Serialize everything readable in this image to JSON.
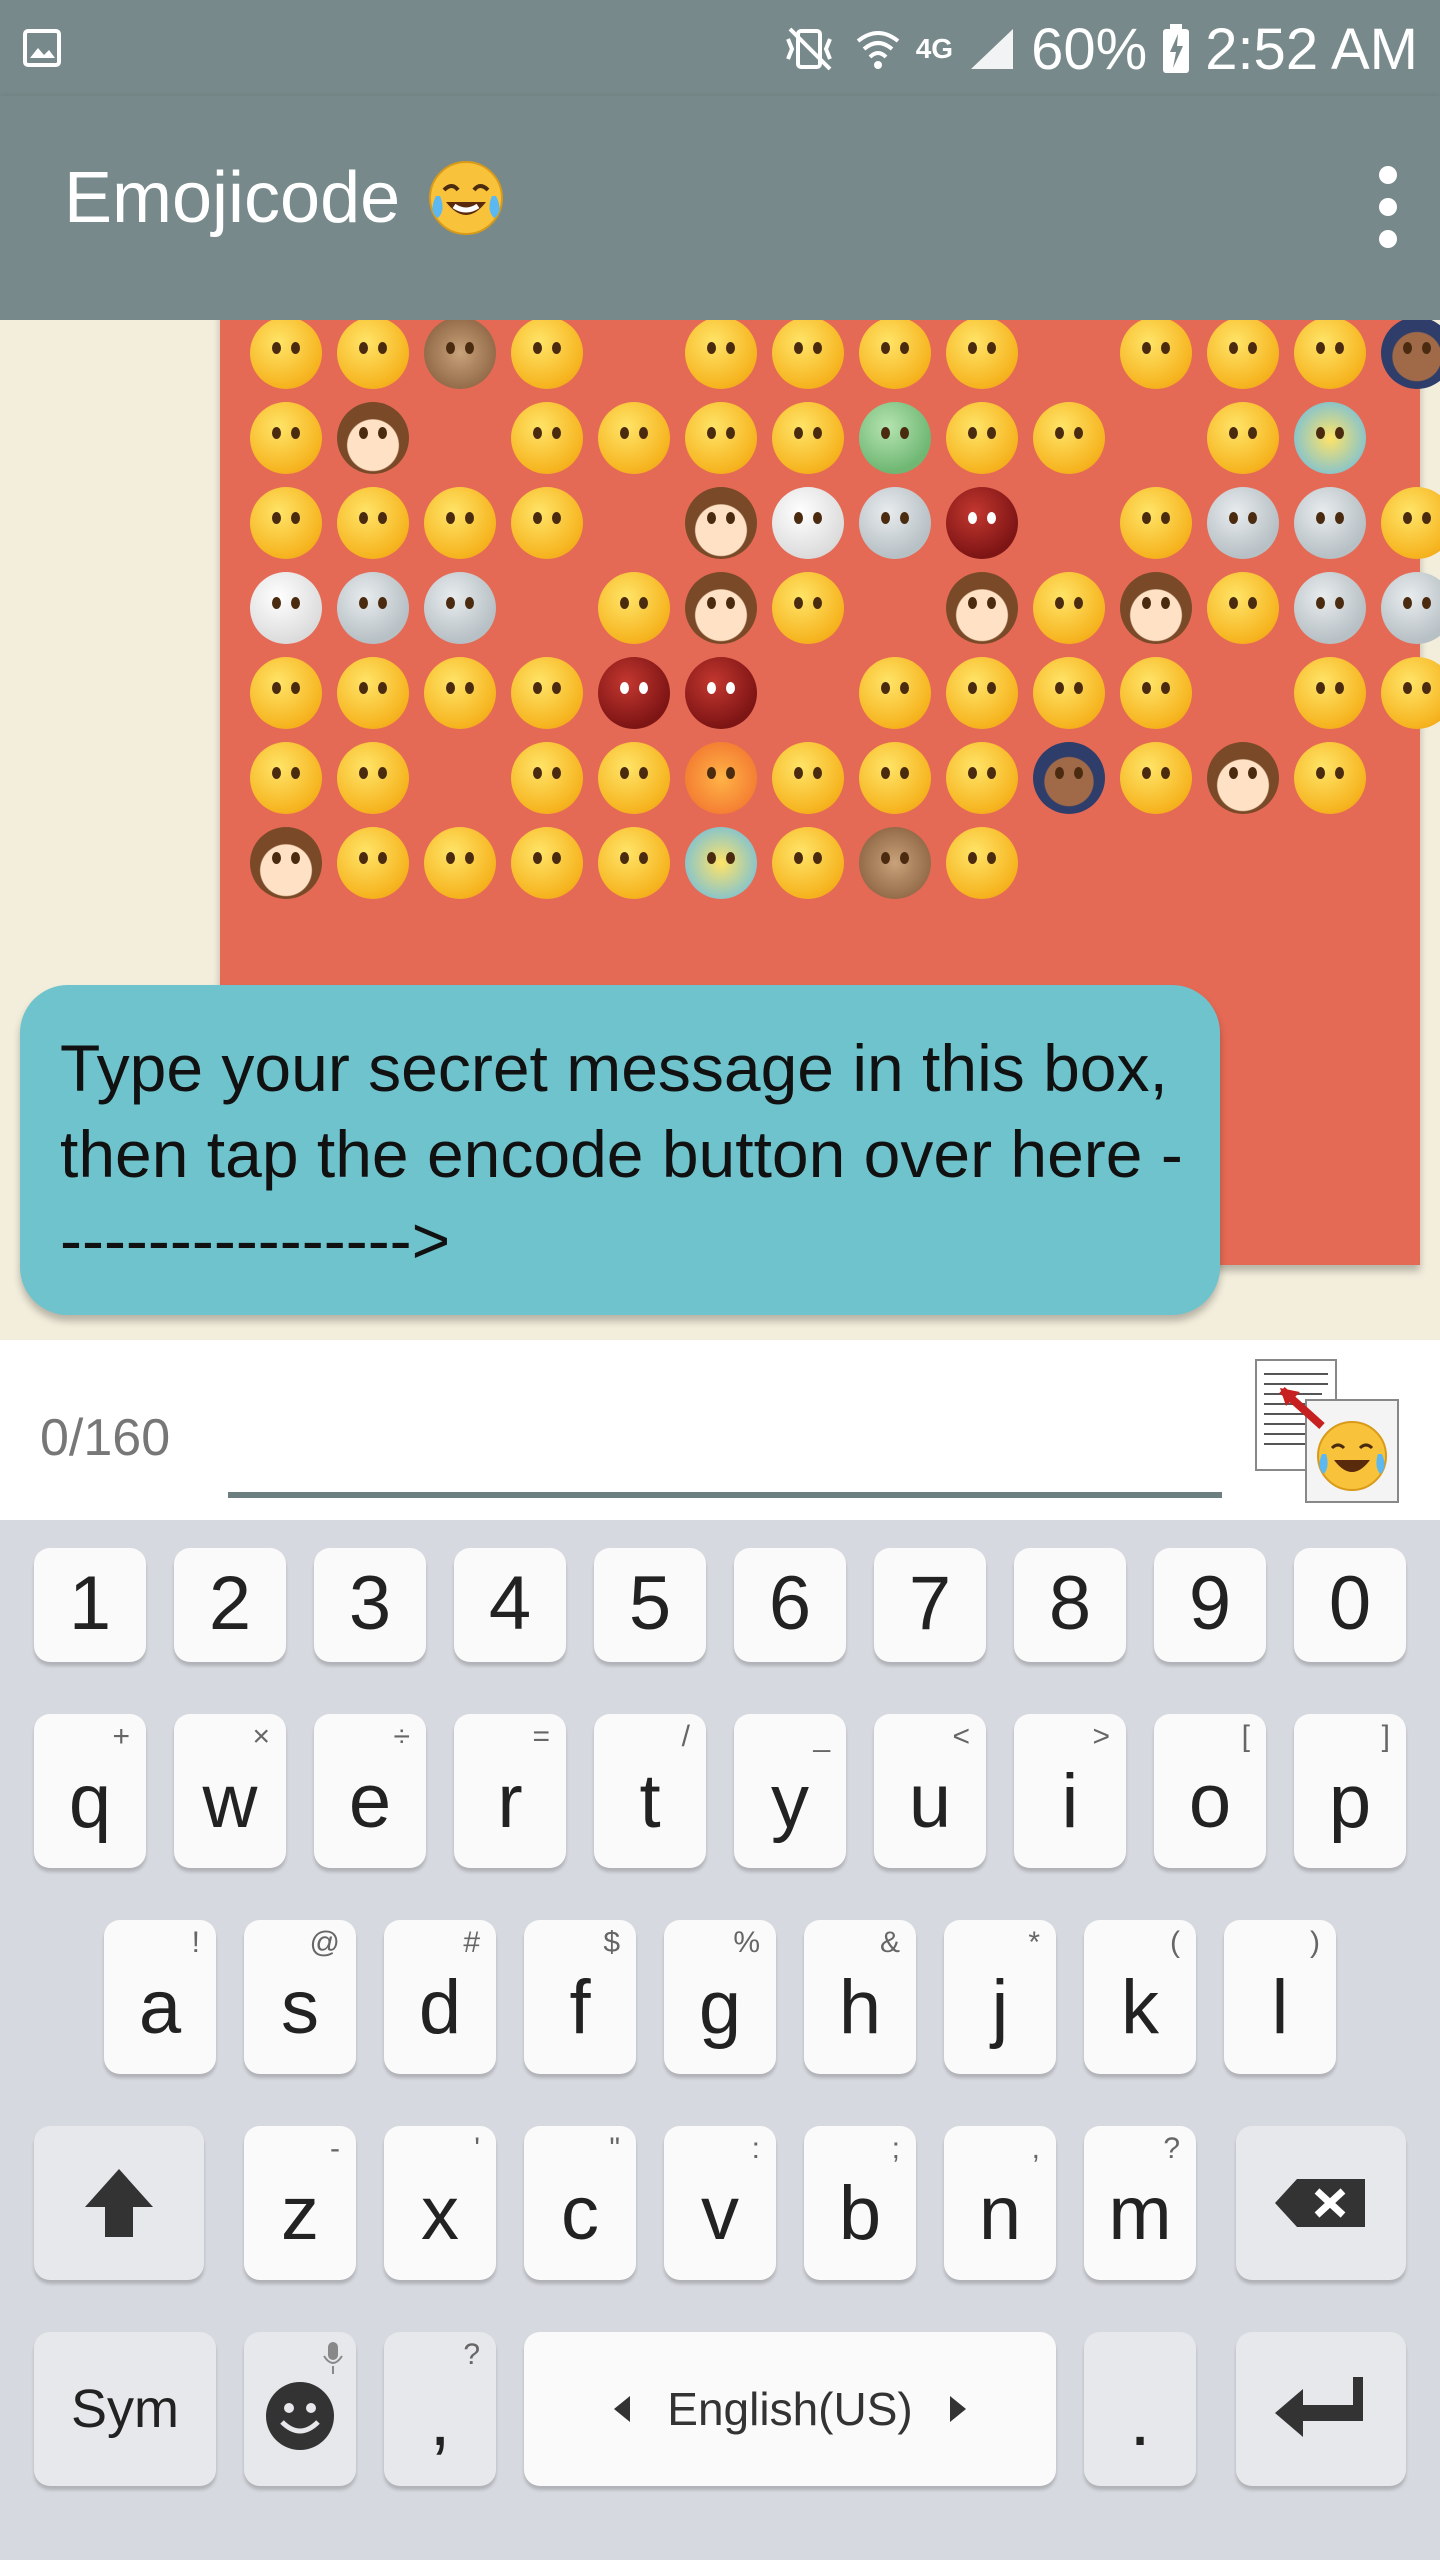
{
  "status_bar": {
    "battery": "60%",
    "time": "2:52 AM",
    "network": "4G"
  },
  "app_bar": {
    "title": "Emojicode"
  },
  "chat": {
    "hint_message": "Type your secret message in this box, then tap the encode button over here  ----------------->"
  },
  "input": {
    "counter": "0/160",
    "value": "",
    "placeholder": ""
  },
  "keyboard": {
    "number_row": [
      "1",
      "2",
      "3",
      "4",
      "5",
      "6",
      "7",
      "8",
      "9",
      "0"
    ],
    "row1": [
      {
        "key": "q",
        "sub": "+"
      },
      {
        "key": "w",
        "sub": "×"
      },
      {
        "key": "e",
        "sub": "÷"
      },
      {
        "key": "r",
        "sub": "="
      },
      {
        "key": "t",
        "sub": "/"
      },
      {
        "key": "y",
        "sub": "_"
      },
      {
        "key": "u",
        "sub": "<"
      },
      {
        "key": "i",
        "sub": ">"
      },
      {
        "key": "o",
        "sub": "["
      },
      {
        "key": "p",
        "sub": "]"
      }
    ],
    "row2": [
      {
        "key": "a",
        "sub": "!"
      },
      {
        "key": "s",
        "sub": "@"
      },
      {
        "key": "d",
        "sub": "#"
      },
      {
        "key": "f",
        "sub": "$"
      },
      {
        "key": "g",
        "sub": "%"
      },
      {
        "key": "h",
        "sub": "&"
      },
      {
        "key": "j",
        "sub": "*"
      },
      {
        "key": "k",
        "sub": "("
      },
      {
        "key": "l",
        "sub": ")"
      }
    ],
    "row3": [
      {
        "key": "z",
        "sub": "-"
      },
      {
        "key": "x",
        "sub": "'"
      },
      {
        "key": "c",
        "sub": "\""
      },
      {
        "key": "v",
        "sub": ":"
      },
      {
        "key": "b",
        "sub": ";"
      },
      {
        "key": "n",
        "sub": ","
      },
      {
        "key": "m",
        "sub": "?"
      }
    ],
    "sym_label": "Sym",
    "comma_label": ",",
    "comma_sub": "?",
    "space_label": "English(US)",
    "period_label": "."
  },
  "colors": {
    "app_bar": "#77898A",
    "emoji_bubble": "#E56A55",
    "hint_bubble": "#6EC3CC",
    "chat_background": "#F3EEDC",
    "keyboard_background": "#D6D9DF"
  }
}
